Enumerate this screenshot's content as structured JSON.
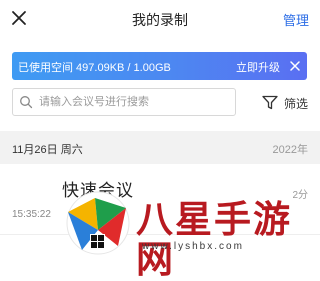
{
  "header": {
    "title": "我的录制",
    "manage_label": "管理"
  },
  "storage": {
    "usage_text": "已使用空间 497.09KB / 1.00GB",
    "upgrade_label": "立即升级"
  },
  "search": {
    "placeholder": "请输入会议号进行搜索",
    "value": ""
  },
  "filter": {
    "label": "筛选"
  },
  "date_group": {
    "date": "11月26日 周六",
    "year": "2022年"
  },
  "recordings": [
    {
      "title": "快速会议",
      "time": "15:35:22",
      "duration": "2分"
    }
  ],
  "watermark": {
    "text": "八星手游网",
    "url": "www.lyshbx.com"
  },
  "colors": {
    "accent": "#2d6ee6",
    "storage_bar_start": "#3f9bf3",
    "storage_bar_end": "#5a6ff2",
    "watermark_red": "#b81a20"
  }
}
